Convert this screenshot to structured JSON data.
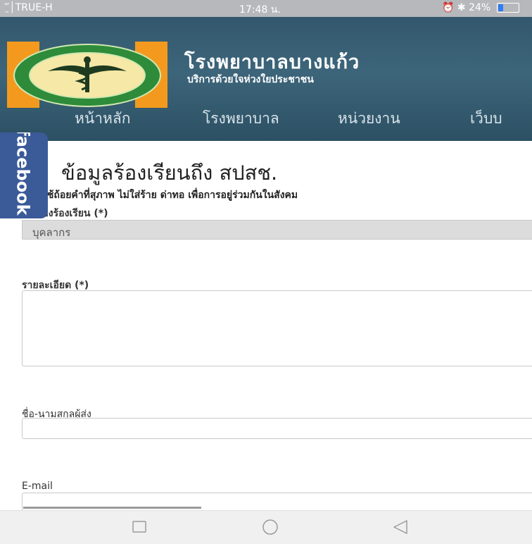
{
  "status": {
    "carrier": "‴̤│TRUE-H",
    "time": "17:48 น.",
    "battery": "24%",
    "battery_level": 0.24,
    "icons": [
      "signal-icon",
      "alarm-icon",
      "bluetooth-icon",
      "battery-icon"
    ]
  },
  "header": {
    "hospital_name": "โรงพยาบาลบางแก้ว",
    "slogan": "บริการด้วยใจห่วงใยประชาชน",
    "nav": [
      "หน้าหลัก",
      "โรงพยาบาล",
      "หน่วยงาน",
      "เว็บบ"
    ]
  },
  "facebook_tab": {
    "label": "facebook"
  },
  "form": {
    "title": "ข้อมูลร้องเรียนถึง สปสช.",
    "notice": "ใช้ถ้อยคำที่สุภาพ ไม่ใส่ร้าย ด่าทอ เพื่อการอยู่ร่วมกันในสังคม",
    "subject_label": "หัวเรื่องร้องเรียน (*)",
    "subject_value": "บุคลากร",
    "detail_label": "รายละเอียด (*)",
    "name_label": "ชื่อ-นามสกุลผู้ส่ง",
    "email_label": "E-mail"
  },
  "colors": {
    "header_bg": "#3a6176",
    "facebook_blue": "#3a5a98",
    "status_bar": "#b6b8bc",
    "logo_orange": "#f39a1e"
  },
  "system_nav": [
    "square-button",
    "circle-button",
    "back-triangle-button"
  ]
}
